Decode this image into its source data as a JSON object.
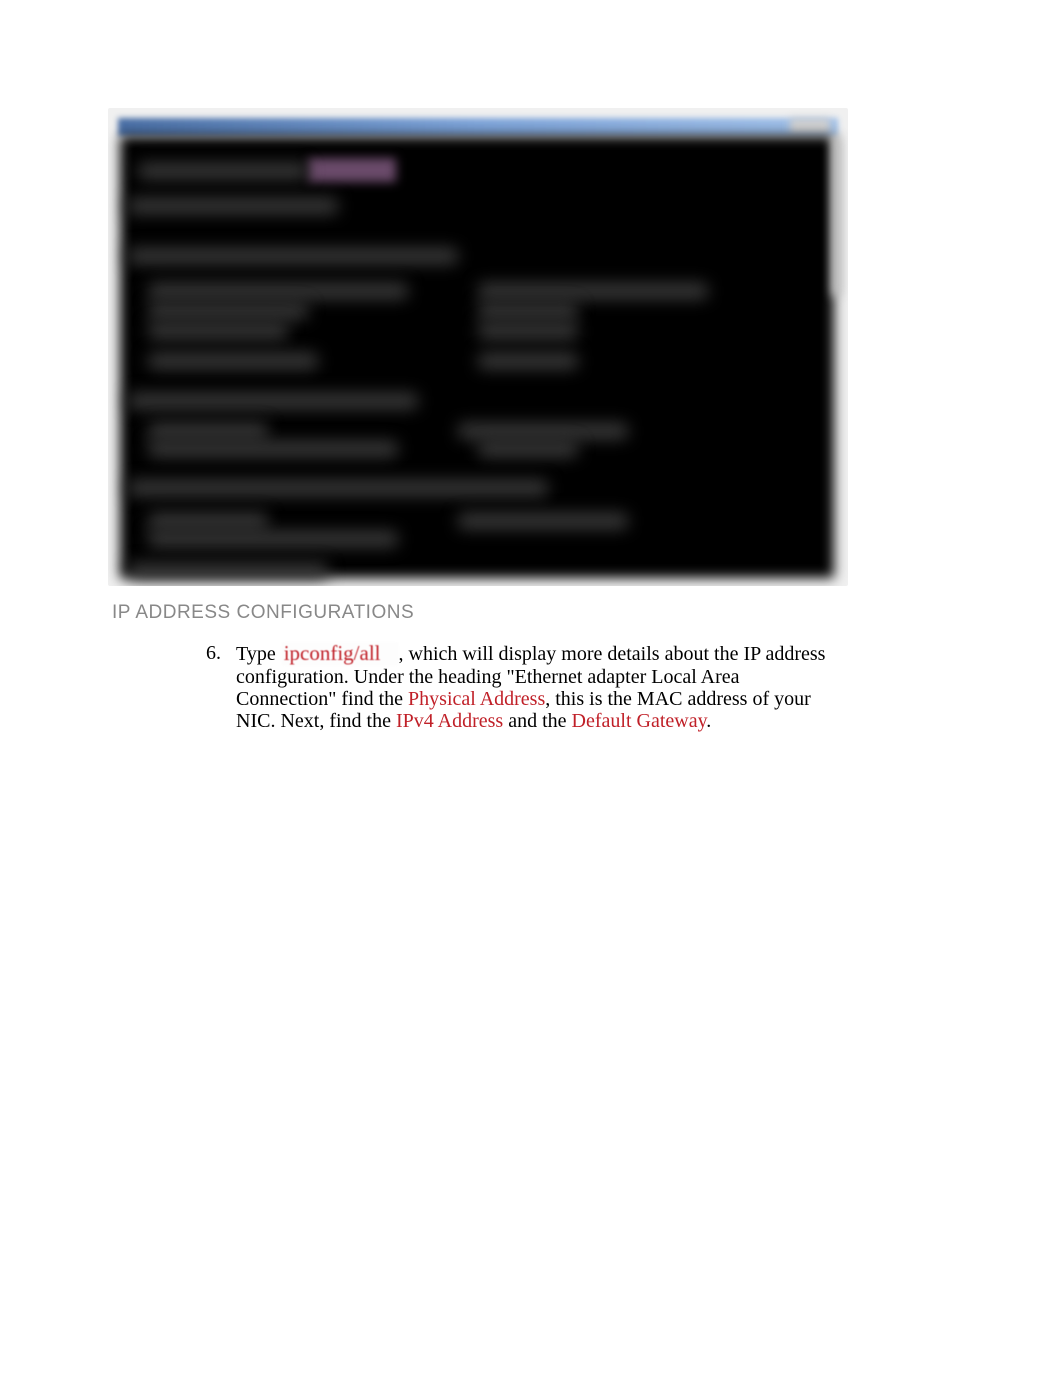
{
  "figure": {
    "caption": "IP ADDRESS CONFIGURATIONS"
  },
  "step": {
    "number": "6.",
    "parts": {
      "p1": "Type ",
      "cmd": "ipconfig/all",
      "p2": ", which will display more details about the IP address configuration. Under the heading \"Ethernet adapter Local Area Connection\" find the ",
      "term1": "Physical Address",
      "p3": ", this is the MAC address of your NIC. Next, find the ",
      "term2": "IPv4 Address",
      "p4": " and the ",
      "term3": "Default Gateway",
      "p5": "."
    }
  }
}
